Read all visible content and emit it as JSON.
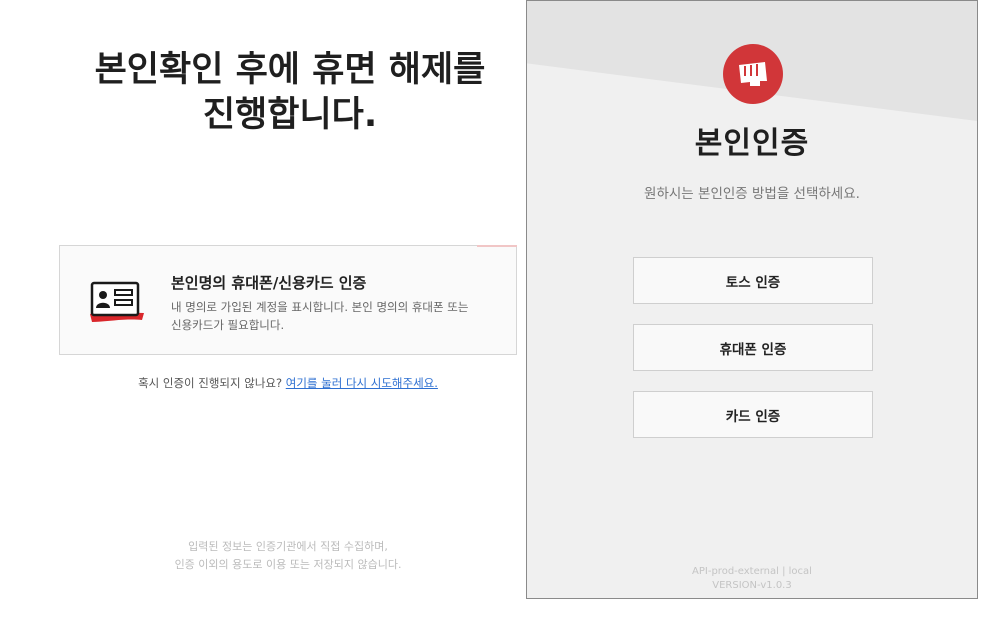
{
  "left": {
    "headline_line1": "본인확인 후에 휴면 해제를",
    "headline_line2": "진행합니다.",
    "card": {
      "title": "본인명의 휴대폰/신용카드 인증",
      "desc_line1": "내 명의로 가입된 계정을 표시합니다. 본인 명의의 휴대폰 또는",
      "desc_line2": "신용카드가 필요합니다."
    },
    "retry_text": "혹시 인증이 진행되지 않나요?",
    "retry_link": "여기를 눌러 다시 시도해주세요.",
    "notice_line1": "입력된 정보는 인증기관에서 직접 수집하며,",
    "notice_line2": "인증 이외의 용도로 이용 또는 저장되지 않습니다."
  },
  "panel": {
    "title": "본인인증",
    "subtitle": "원하시는 본인인증 방법을 선택하세요.",
    "buttons": [
      "토스 인증",
      "휴대폰 인증",
      "카드 인증"
    ],
    "footer_line1": "API-prod-external | local",
    "footer_line2": "VERSION-v1.0.3"
  },
  "colors": {
    "brand_red": "#d13639",
    "link_blue": "#2d6fd1"
  },
  "icons": {
    "card_icon": "id-card-icon",
    "logo_icon": "fist-logo-icon"
  }
}
